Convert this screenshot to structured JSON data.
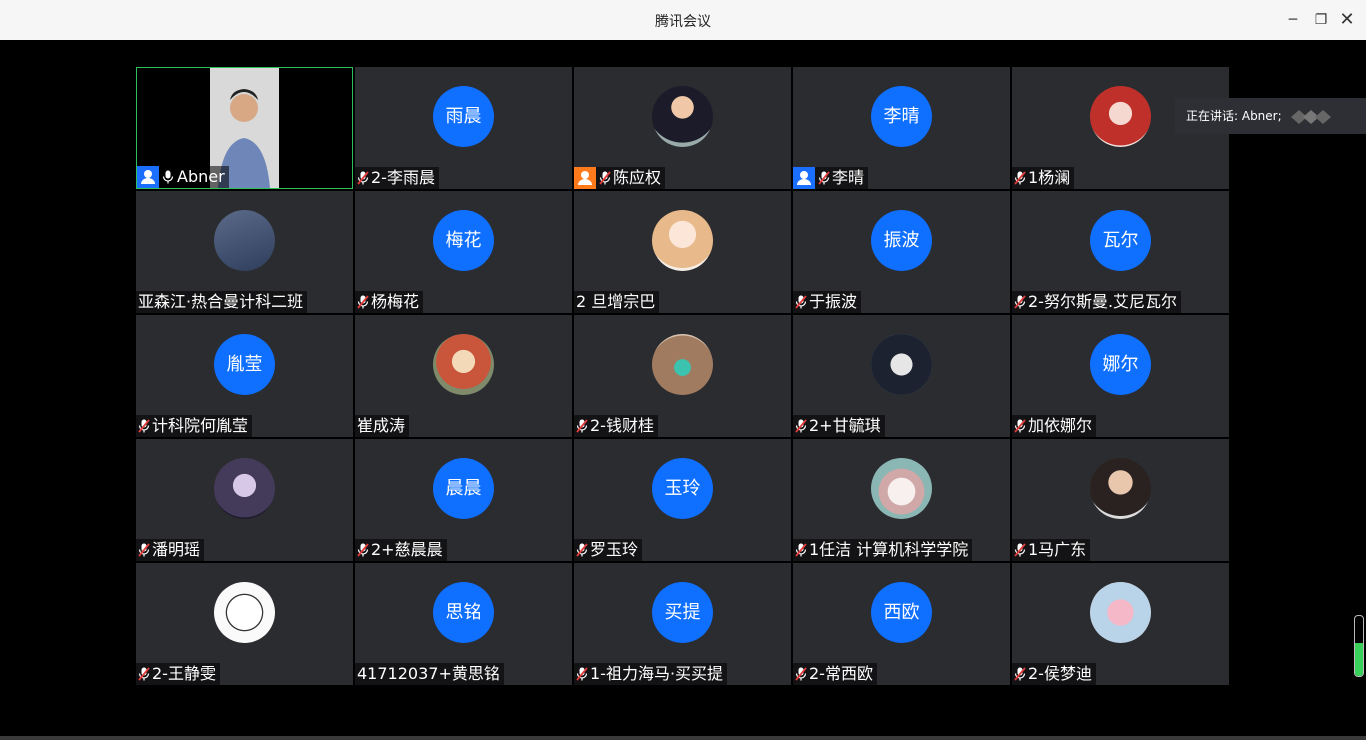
{
  "window": {
    "title": "腾讯会议",
    "minimize": "─",
    "maximize": "❐",
    "close": "✕"
  },
  "speaking": {
    "label": "正在讲话: Abner;"
  },
  "mic_level": 0.55,
  "participants": [
    {
      "name": "Abner",
      "type": "video",
      "badge": "blue",
      "mic": "on"
    },
    {
      "name": "2-李雨晨",
      "avatar_text": "雨晨",
      "mic": "off"
    },
    {
      "name": "陈应权",
      "avatar_pic": "photo",
      "badge": "orange",
      "mic": "off"
    },
    {
      "name": "李晴",
      "avatar_text": "李晴",
      "badge": "blue",
      "mic": "off"
    },
    {
      "name": "1杨澜",
      "avatar_pic": "redhair",
      "mic": "off"
    },
    {
      "name": "亚森江·热合曼计科二班",
      "avatar_pic": "soccer",
      "mic": "none"
    },
    {
      "name": "杨梅花",
      "avatar_text": "梅花",
      "mic": "off"
    },
    {
      "name": "2  旦增宗巴",
      "avatar_pic": "girl",
      "mic": "none"
    },
    {
      "name": "于振波",
      "avatar_text": "振波",
      "mic": "off"
    },
    {
      "name": "2-努尔斯曼.艾尼瓦尔",
      "avatar_text": "瓦尔",
      "mic": "off"
    },
    {
      "name": "计科院何胤莹",
      "avatar_text": "胤莹",
      "mic": "off"
    },
    {
      "name": "崔成涛",
      "avatar_pic": "anime",
      "mic": "none"
    },
    {
      "name": "2-钱财桂",
      "avatar_pic": "dog",
      "mic": "off"
    },
    {
      "name": "2+甘毓琪",
      "avatar_pic": "manga",
      "mic": "off"
    },
    {
      "name": "加依娜尔",
      "avatar_text": "娜尔",
      "mic": "off"
    },
    {
      "name": "潘明瑶",
      "avatar_pic": "purple",
      "mic": "off"
    },
    {
      "name": "2+慈晨晨",
      "avatar_text": "晨晨",
      "mic": "off"
    },
    {
      "name": "罗玉玲",
      "avatar_text": "玉玲",
      "mic": "off"
    },
    {
      "name": "1任洁 计算机科学学院",
      "avatar_pic": "cartoon",
      "mic": "off"
    },
    {
      "name": "1马广东",
      "avatar_pic": "boy",
      "mic": "off"
    },
    {
      "name": "2-王静雯",
      "avatar_pic": "sketch",
      "mic": "off"
    },
    {
      "name": "41712037+黄思铭",
      "avatar_text": "思铭",
      "mic": "none"
    },
    {
      "name": "1-祖力海马·买买提",
      "avatar_text": "买提",
      "mic": "off"
    },
    {
      "name": "2-常西欧",
      "avatar_text": "西欧",
      "mic": "off"
    },
    {
      "name": "2-侯梦迪",
      "avatar_pic": "pink",
      "mic": "off"
    }
  ],
  "colors": {
    "accent": "#0f6fff",
    "tile_bg": "#2b2c30",
    "active_border": "#2fbf5b",
    "muted_red": "#e23b3b"
  }
}
